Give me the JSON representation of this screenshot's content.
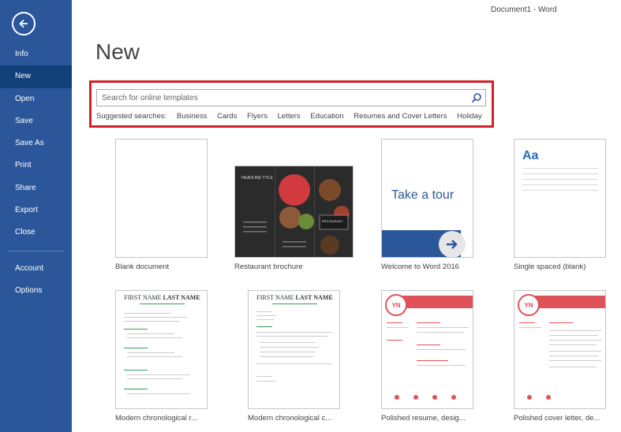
{
  "window": {
    "title": "Document1 - Word"
  },
  "sidebar": {
    "items": [
      {
        "label": "Info"
      },
      {
        "label": "New"
      },
      {
        "label": "Open"
      },
      {
        "label": "Save"
      },
      {
        "label": "Save As"
      },
      {
        "label": "Print"
      },
      {
        "label": "Share"
      },
      {
        "label": "Export"
      },
      {
        "label": "Close"
      }
    ],
    "bottom_items": [
      {
        "label": "Account"
      },
      {
        "label": "Options"
      }
    ],
    "active": "New"
  },
  "page": {
    "title": "New"
  },
  "search": {
    "placeholder": "Search for online templates",
    "suggested_label": "Suggested searches:",
    "suggestions": [
      "Business",
      "Cards",
      "Flyers",
      "Letters",
      "Education",
      "Resumes and Cover Letters",
      "Holiday"
    ]
  },
  "templates": [
    {
      "label": "Blank document"
    },
    {
      "label": "Restaurant brochure"
    },
    {
      "label": "Welcome to Word 2016"
    },
    {
      "label": "Single spaced (blank)"
    },
    {
      "label": "Modern chronological r..."
    },
    {
      "label": "Modern chronological c..."
    },
    {
      "label": "Polished resume, desig..."
    },
    {
      "label": "Polished cover letter, de..."
    }
  ],
  "thumbnail_text": {
    "tour": "Take a tour",
    "aa": "Aa",
    "resume_name_first": "FIRST NAME",
    "resume_name_last": "LAST NAME",
    "yn": "YN",
    "brochure_heading": "HEADLINE TITLE",
    "brochure_badge": "RESTAURANT"
  },
  "colors": {
    "sidebar_bg": "#2b579a",
    "sidebar_active": "#124078",
    "highlight_border": "#d0202a",
    "tour_blue": "#2b579a",
    "polished_red": "#e0525a"
  }
}
